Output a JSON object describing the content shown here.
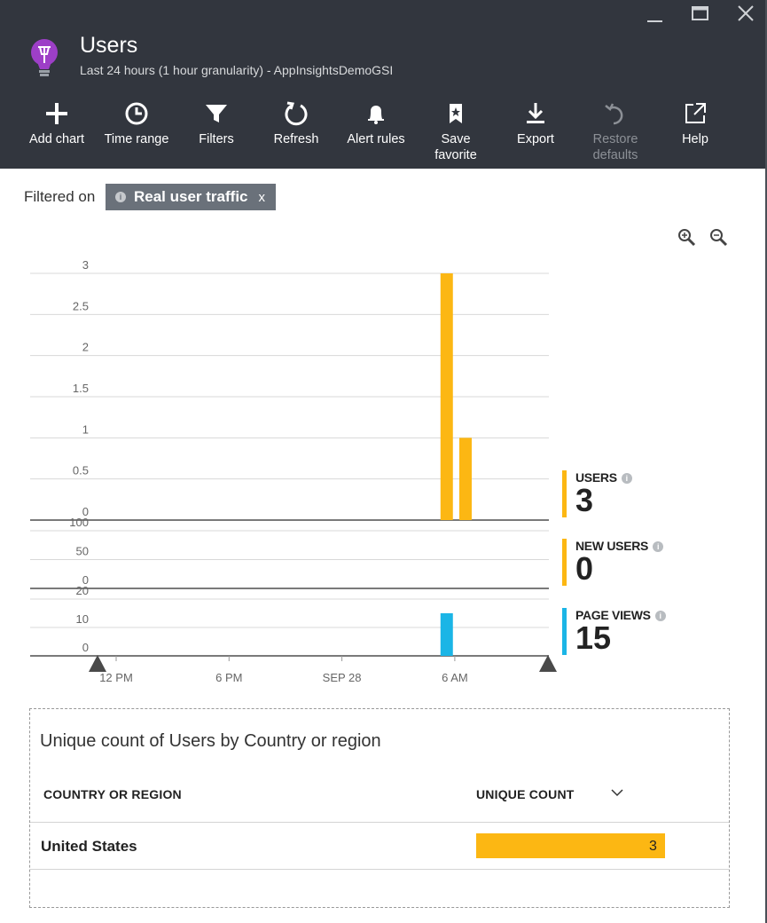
{
  "window": {
    "title": "Users",
    "subtitle": "Last 24 hours (1 hour granularity) - AppInsightsDemoGSI"
  },
  "toolbar": {
    "add_chart": "Add chart",
    "time_range": "Time range",
    "filters": "Filters",
    "refresh": "Refresh",
    "alert_rules": "Alert rules",
    "save_favorite_1": "Save",
    "save_favorite_2": "favorite",
    "export": "Export",
    "restore_defaults_1": "Restore",
    "restore_defaults_2": "defaults",
    "help": "Help"
  },
  "filter": {
    "label": "Filtered on",
    "chip": "Real user traffic",
    "remove": "x"
  },
  "colors": {
    "header_bg": "#32363e",
    "users": "#fcb713",
    "page_views": "#1bb5e6",
    "chip_bg": "#6a717a"
  },
  "chart_data": [
    {
      "type": "bar",
      "series": [
        {
          "name": "USERS",
          "color": "#fcb713",
          "values": [
            {
              "x_hour": 22,
              "y": 3
            },
            {
              "x_hour": 23,
              "y": 1
            }
          ]
        }
      ],
      "y_ticks": [
        "3",
        "2.5",
        "2",
        "1.5",
        "1",
        "0.5",
        "0"
      ],
      "ylim": [
        0,
        3
      ]
    },
    {
      "type": "bar",
      "series": [
        {
          "name": "NEW USERS",
          "color": "#fcb713",
          "values": []
        }
      ],
      "y_ticks": [
        "100",
        "50",
        "0"
      ],
      "ylim": [
        0,
        100
      ]
    },
    {
      "type": "bar",
      "series": [
        {
          "name": "PAGE VIEWS",
          "color": "#1bb5e6",
          "values": [
            {
              "x_hour": 22,
              "y": 15
            }
          ]
        }
      ],
      "y_ticks": [
        "20",
        "10",
        "0"
      ],
      "ylim": [
        0,
        20
      ]
    }
  ],
  "x_axis": {
    "ticks": [
      {
        "label": "12 PM",
        "hour": 0
      },
      {
        "label": "6 PM",
        "hour": 6
      },
      {
        "label": "SEP 28",
        "hour": 12
      },
      {
        "label": "6 AM",
        "hour": 18
      }
    ]
  },
  "legend": [
    {
      "name": "USERS",
      "value": "3",
      "color": "#fcb713"
    },
    {
      "name": "NEW USERS",
      "value": "0",
      "color": "#fcb713"
    },
    {
      "name": "PAGE VIEWS",
      "value": "15",
      "color": "#1bb5e6"
    }
  ],
  "grid": {
    "title": "Unique count of Users by Country or region",
    "col_country": "COUNTRY OR REGION",
    "col_count": "UNIQUE COUNT",
    "rows": [
      {
        "country": "United States",
        "count": "3",
        "fraction": 1.0
      }
    ]
  }
}
